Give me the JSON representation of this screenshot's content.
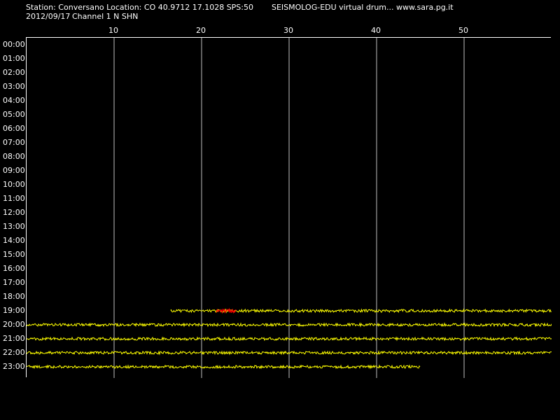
{
  "header": {
    "station": "Station: Conversano Location: CO 40.9712 17.1028 SPS:50",
    "program": "SEISMOLOG-EDU virtual drum... www.sara.pg.it",
    "date": "2012/09/17",
    "channel": "Channel 1 N SHN"
  },
  "colors": {
    "background": "#000000",
    "trace": "#ffff00",
    "event": "#ff0000",
    "grid": "#ffffff",
    "text": "#ffffff"
  },
  "chart_data": {
    "type": "line",
    "title": "",
    "xlabel": "",
    "ylabel": "",
    "x_range": [
      0,
      60
    ],
    "x_ticks": [
      10,
      20,
      30,
      40,
      50
    ],
    "x_tick_labels": [
      "10",
      "20",
      "30",
      "40",
      "50"
    ],
    "hour_labels": [
      "00:00",
      "01:00",
      "02:00",
      "03:00",
      "04:00",
      "05:00",
      "06:00",
      "07:00",
      "08:00",
      "09:00",
      "10:00",
      "11:00",
      "12:00",
      "13:00",
      "14:00",
      "15:00",
      "16:00",
      "17:00",
      "18:00",
      "19:00",
      "20:00",
      "21:00",
      "22:00",
      "23:00"
    ],
    "grid": true,
    "series": [
      {
        "hour": 19,
        "start_min": 16.5,
        "end_min": 60
      },
      {
        "hour": 20,
        "start_min": 0,
        "end_min": 60
      },
      {
        "hour": 21,
        "start_min": 0,
        "end_min": 60
      },
      {
        "hour": 22,
        "start_min": 0,
        "end_min": 60
      },
      {
        "hour": 23,
        "start_min": 0,
        "end_min": 45
      }
    ],
    "events": [
      {
        "hour": 19,
        "start_min": 21.7,
        "end_min": 24
      }
    ]
  }
}
